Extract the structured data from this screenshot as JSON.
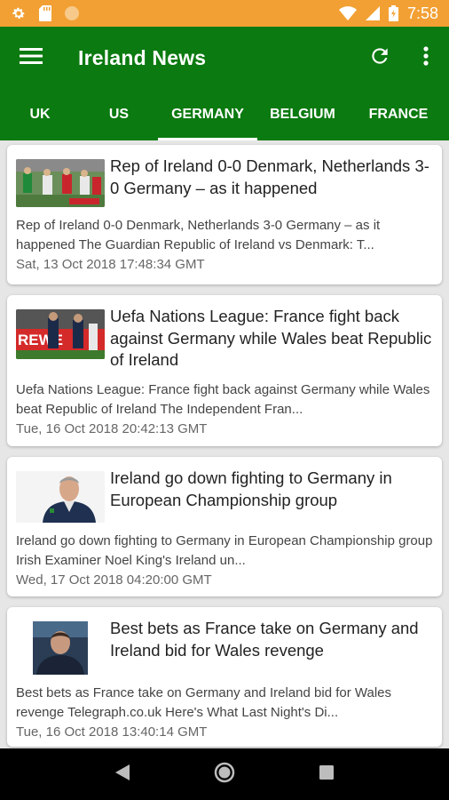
{
  "status_bar": {
    "time": "7:58",
    "icons": [
      "gear-icon",
      "sd-card-icon",
      "circle-icon",
      "wifi-icon",
      "signal-icon",
      "battery-icon"
    ]
  },
  "app_bar": {
    "title": "Ireland News",
    "icons": [
      "menu-icon",
      "refresh-icon",
      "more-vert-icon"
    ]
  },
  "tabs": [
    {
      "label": "UK"
    },
    {
      "label": "US"
    },
    {
      "label": "GERMANY",
      "active": true
    },
    {
      "label": "BELGIUM"
    },
    {
      "label": "FRANCE"
    }
  ],
  "articles": [
    {
      "headline": "Rep of Ireland 0-0 Denmark, Netherlands 3-0 Germany – as it happened",
      "summary": "Rep of Ireland 0-0 Denmark, Netherlands 3-0 Germany – as it happened  The Guardian  Republic of Ireland vs Denmark: T...",
      "date": "Sat, 13 Oct 2018 17:48:34 GMT"
    },
    {
      "headline": "Uefa Nations League: France fight back against Germany while Wales beat Republic of Ireland",
      "summary": "Uefa Nations League: France fight back against Germany while Wales beat Republic of Ireland  The Independent  Fran...",
      "date": "Tue, 16 Oct 2018 20:42:13 GMT",
      "thumb_text": "REWE"
    },
    {
      "headline": "Ireland go down fighting to Germany in European Championship group",
      "summary": "Ireland go down fighting to Germany in European Championship group  Irish Examiner  Noel King's Ireland un...",
      "date": "Wed, 17 Oct 2018 04:20:00 GMT"
    },
    {
      "headline": "Best bets as France take on Germany and Ireland bid for Wales revenge",
      "summary": "Best bets as France take on Germany and Ireland bid for Wales revenge  Telegraph.co.uk  Here's What Last Night's Di...",
      "date": "Tue, 16 Oct 2018 13:40:14 GMT"
    }
  ],
  "nav_bar": {
    "icons": [
      "back-icon",
      "home-icon",
      "recents-icon"
    ]
  },
  "colors": {
    "status_bar": "#f2a033",
    "primary": "#0b7a10",
    "background": "#e6e6e6"
  }
}
